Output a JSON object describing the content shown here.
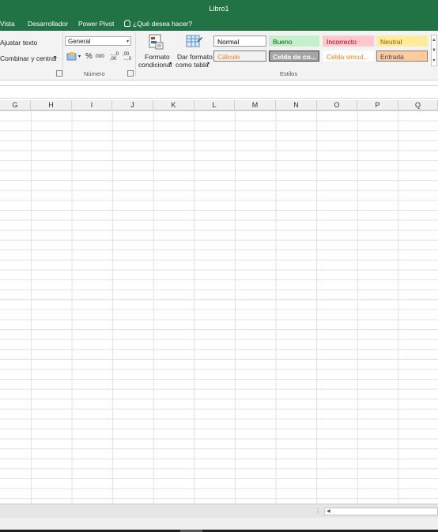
{
  "window": {
    "title": "Libro1"
  },
  "tabs": [
    "Vista",
    "Desarrollador",
    "Power Pivot"
  ],
  "tell_me": "¿Qué desea hacer?",
  "alignment": {
    "wrap_text": "Ajustar texto",
    "merge_center": "Combinar y centrar"
  },
  "number": {
    "format_value": "General",
    "percent": "%",
    "thousands": "000",
    "inc_decimal": "←,0 ,00",
    "dec_decimal": ",00 →,0",
    "group_label": "Número"
  },
  "styles": {
    "conditional_line1": "Formato",
    "conditional_line2": "condicional",
    "table_line1": "Dar formato",
    "table_line2": "como tabla",
    "group_label": "Estilos",
    "cells": [
      {
        "label": "Normal",
        "bg": "#ffffff",
        "fg": "#000000",
        "border": "#9b9b9b"
      },
      {
        "label": "Bueno",
        "bg": "#c6efce",
        "fg": "#006100",
        "border": "#c6efce"
      },
      {
        "label": "Incorrecto",
        "bg": "#ffc7ce",
        "fg": "#9c0006",
        "border": "#ffc7ce"
      },
      {
        "label": "Neutral",
        "bg": "#ffeb9c",
        "fg": "#9c5700",
        "border": "#ffeb9c"
      },
      {
        "label": "Cálculo",
        "bg": "#f2f2f2",
        "fg": "#fa7d00",
        "border": "#7f7f7f"
      },
      {
        "label": "Celda de co...",
        "bg": "#a5a5a5",
        "fg": "#ffffff",
        "border": "#3f3f3f"
      },
      {
        "label": "Celda vincul...",
        "bg": "#ffffff",
        "fg": "#fa7d00",
        "border": "#ffffff"
      },
      {
        "label": "Entrada",
        "bg": "#ffcc99",
        "fg": "#3f3f76",
        "border": "#7f7f7f"
      }
    ]
  },
  "columns": [
    "G",
    "H",
    "I",
    "J",
    "K",
    "L",
    "M",
    "N",
    "O",
    "P",
    "Q"
  ],
  "colors": {
    "brand": "#217346"
  }
}
